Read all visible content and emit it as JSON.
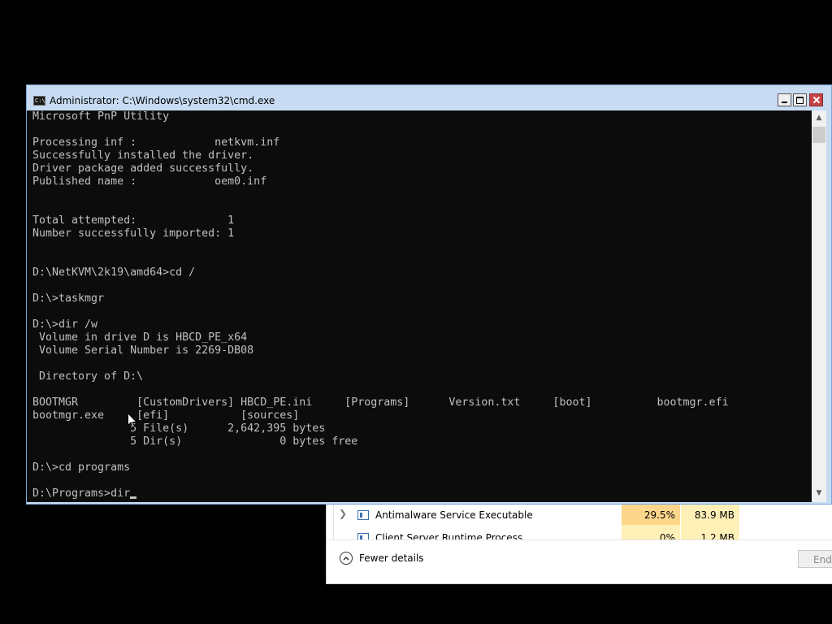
{
  "task_manager": {
    "processes": [
      {
        "name": "Antimalware Service Executable",
        "cpu": "29.5%",
        "memory": "83.9 MB",
        "icon": "service-app-icon"
      },
      {
        "name": "Client Server Runtime Process",
        "cpu": "0%",
        "memory": "1.2 MB",
        "icon": "service-app-icon"
      }
    ],
    "fewer_details_label": "Fewer details",
    "end_task_label": "End",
    "colors": {
      "cpu_highlight": "#fcd68b",
      "memory_highlight": "#fff0b8"
    }
  },
  "cmd_window": {
    "title": "Administrator: C:\\Windows\\system32\\cmd.exe",
    "icon_glyph": "C:\\",
    "buttons": {
      "minimize": "minimize-icon",
      "maximize": "maximize-icon",
      "close": "close-icon"
    },
    "console_text": "Microsoft PnP Utility\n\nProcessing inf :            netkvm.inf\nSuccessfully installed the driver.\nDriver package added successfully.\nPublished name :            oem0.inf\n\n\nTotal attempted:              1\nNumber successfully imported: 1\n\n\nD:\\NetKVM\\2k19\\amd64>cd /\n\nD:\\>taskmgr\n\nD:\\>dir /w\n Volume in drive D is HBCD_PE_x64\n Volume Serial Number is 2269-DB08\n\n Directory of D:\\\n\nBOOTMGR         [CustomDrivers] HBCD_PE.ini     [Programs]      Version.txt     [boot]          bootmgr.efi\nbootmgr.exe     [efi]           [sources]\n               5 File(s)      2,642,395 bytes\n               5 Dir(s)               0 bytes free\n\nD:\\>cd programs\n\nD:\\Programs>dir",
    "colors": {
      "background": "#0c0c0c",
      "foreground": "#c0c0c0",
      "titlebar": "#c7dcf3"
    }
  }
}
